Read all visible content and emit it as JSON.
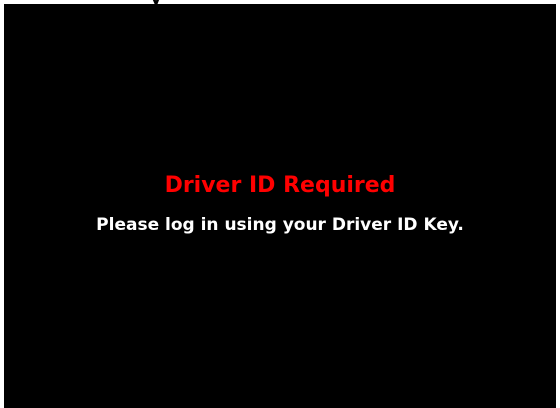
{
  "top_strip": {
    "partial_text": "y"
  },
  "screen": {
    "title": "Driver ID Required",
    "message": "Please log in using your Driver ID Key."
  },
  "colors": {
    "background": "#000000",
    "title": "#ff0000",
    "message": "#ffffff",
    "border": "#ffffff"
  }
}
